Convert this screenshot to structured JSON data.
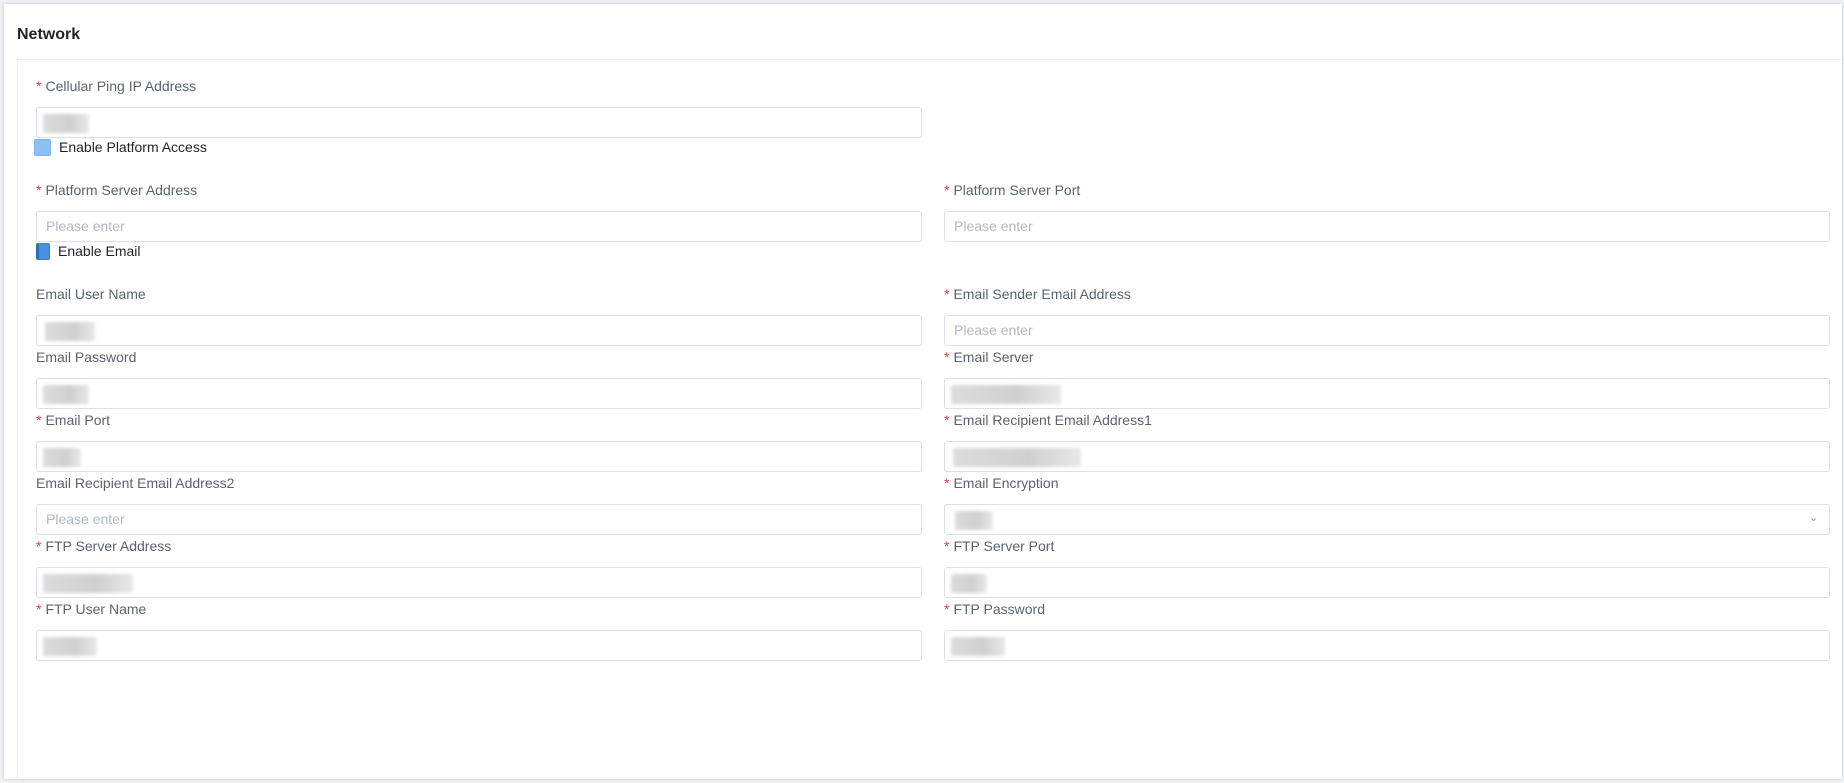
{
  "section": {
    "title": "Network"
  },
  "fields": {
    "cellular_ping_ip": {
      "label": "Cellular Ping IP Address",
      "required": true,
      "value": ""
    },
    "platform_server_address": {
      "label": "Platform Server Address",
      "required": true,
      "placeholder": "Please enter"
    },
    "platform_server_port": {
      "label": "Platform Server Port",
      "required": true,
      "placeholder": "Please enter"
    },
    "email_user_name": {
      "label": "Email User Name",
      "required": false,
      "value": ""
    },
    "email_sender_address": {
      "label": "Email Sender Email Address",
      "required": true,
      "placeholder": "Please enter"
    },
    "email_password": {
      "label": "Email Password",
      "required": false,
      "value": ""
    },
    "email_server": {
      "label": "Email Server",
      "required": true,
      "value": ""
    },
    "email_port": {
      "label": "Email Port",
      "required": true,
      "value": ""
    },
    "email_recipient_1": {
      "label": "Email Recipient Email Address1",
      "required": true,
      "value": ""
    },
    "email_recipient_2": {
      "label": "Email Recipient Email Address2",
      "required": false,
      "placeholder": "Please enter"
    },
    "email_encryption": {
      "label": "Email Encryption",
      "required": true,
      "value": ""
    },
    "ftp_server_address": {
      "label": "FTP Server Address",
      "required": true,
      "value": ""
    },
    "ftp_server_port": {
      "label": "FTP Server Port",
      "required": true,
      "value": ""
    },
    "ftp_user_name": {
      "label": "FTP User Name",
      "required": true,
      "value": ""
    },
    "ftp_password": {
      "label": "FTP Password",
      "required": true,
      "value": ""
    }
  },
  "checkboxes": {
    "enable_platform_access": {
      "label": "Enable Platform Access",
      "checked": true
    },
    "enable_email": {
      "label": "Enable Email",
      "checked": true
    }
  },
  "required_marker": "*",
  "icons": {
    "select_caret": "chevron-down-icon"
  },
  "colors": {
    "required": "#e33b3b",
    "accent": "#4a90e2",
    "label": "#5c6370",
    "placeholder": "#b3b8c2"
  }
}
